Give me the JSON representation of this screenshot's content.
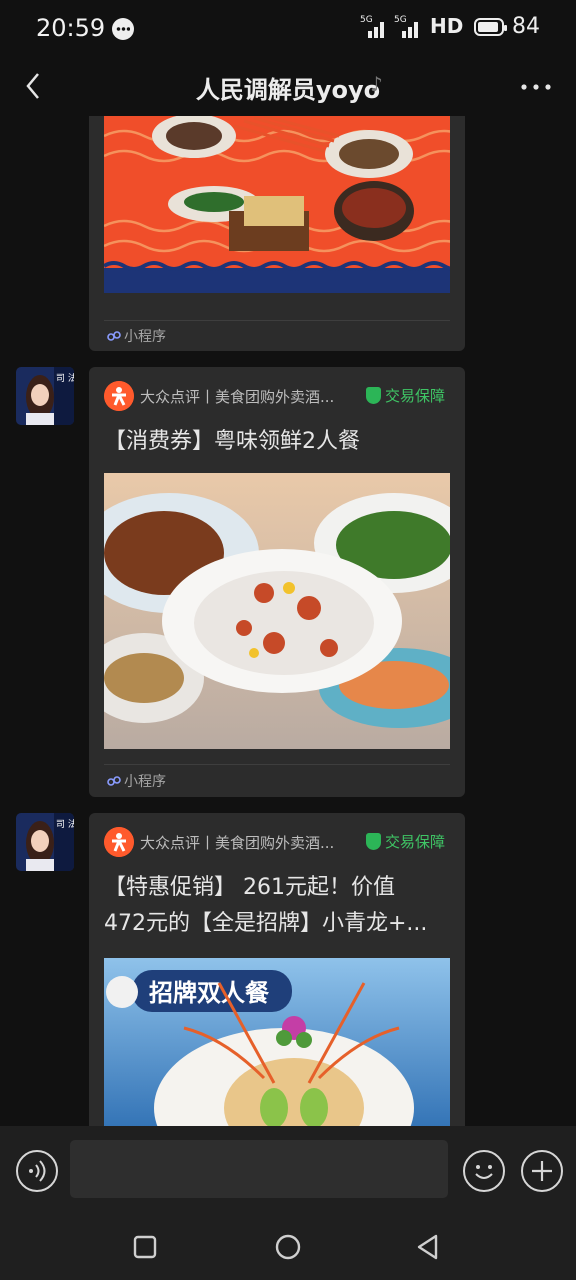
{
  "status_bar": {
    "time": "20:59",
    "network": "HD",
    "battery": "84"
  },
  "header": {
    "title": "人民调解员yoyo"
  },
  "messages": [
    {
      "type": "mini-program",
      "mini_label": "小程序"
    },
    {
      "type": "mini-program",
      "source": "大众点评丨美食团购外卖酒...",
      "guarantee": "交易保障",
      "description": "【消费券】粤味领鲜2人餐",
      "mini_label": "小程序"
    },
    {
      "type": "mini-program",
      "source": "大众点评丨美食团购外卖酒...",
      "guarantee": "交易保障",
      "description_line1": "【特惠促销】 261元起！价值",
      "description_line2": "472元的【全是招牌】小青龙+...",
      "banner_text": "招牌双人餐"
    }
  ],
  "avatar_text": "司 法",
  "colors": {
    "background": "#111111",
    "card": "#2c2c2c",
    "accent_green": "#3fc565",
    "dianping_orange": "#ff5a2c"
  }
}
